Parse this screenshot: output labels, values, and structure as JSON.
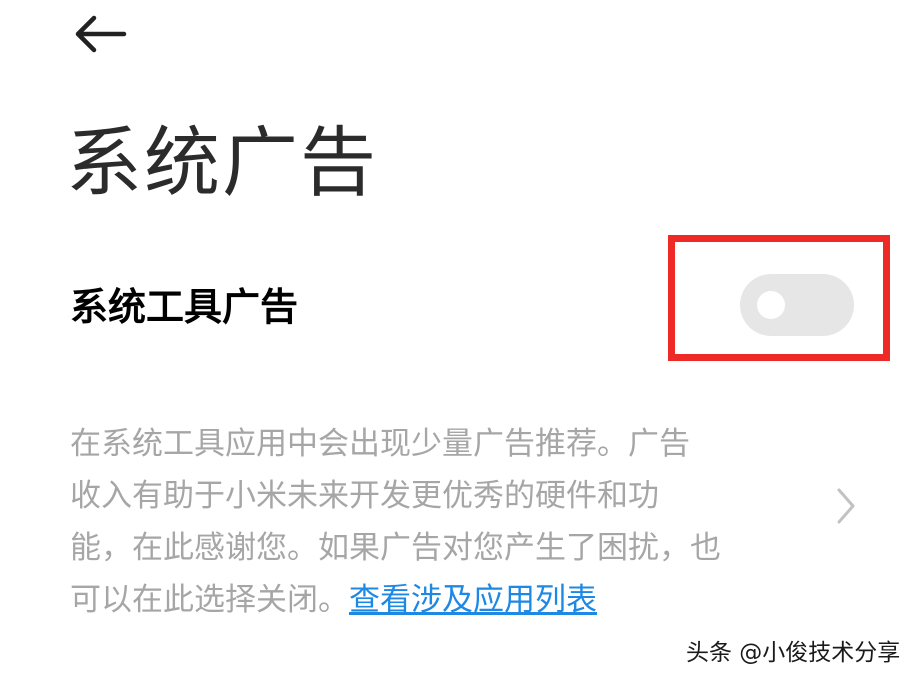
{
  "header": {
    "back_icon": "arrow-left-icon",
    "title": "系统广告"
  },
  "setting": {
    "label": "系统工具广告",
    "toggle_state": "off",
    "highlight_color": "#ee2a27",
    "description_lines": [
      "在系统工具应用中会出现少量广告推荐。广告",
      "收入有助于小米未来开发更优秀的硬件和功",
      "能，在此感谢您。如果广告对您产生了困扰，也",
      "可以在此选择关闭。"
    ],
    "link_text": "查看涉及应用列表",
    "link_color": "#1e88e5",
    "chevron_icon": "chevron-right-icon"
  },
  "watermark": {
    "text": "头条 @小俊技术分享"
  }
}
